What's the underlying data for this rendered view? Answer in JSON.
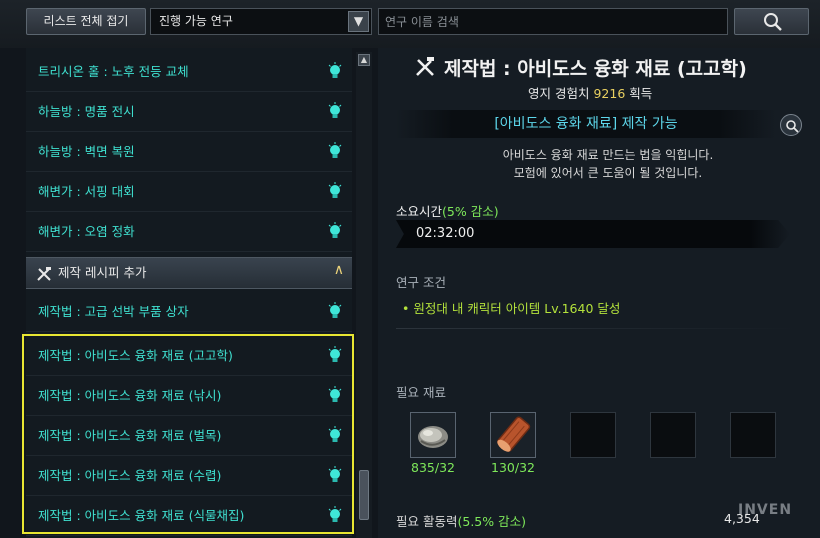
{
  "topbar": {
    "collapse_label": "리스트 전체 접기",
    "filter_value": "진행 가능 연구",
    "search_placeholder": "연구 이름 검색"
  },
  "list": {
    "items": [
      {
        "label": "트리시온 홀 : 노후 전등 교체"
      },
      {
        "label": "하늘방 : 명품 전시"
      },
      {
        "label": "하늘방 : 벽면 복원"
      },
      {
        "label": "해변가 : 서핑 대회"
      },
      {
        "label": "해변가 : 오염 정화"
      }
    ],
    "section_title": "제작 레시피 추가",
    "section_items": [
      {
        "label": "제작법 : 고급 선박 부품 상자"
      },
      {
        "label": "제작법 : 아비도스 융화 재료 (고고학)"
      },
      {
        "label": "제작법 : 아비도스 융화 재료 (낚시)"
      },
      {
        "label": "제작법 : 아비도스 융화 재료 (벌목)"
      },
      {
        "label": "제작법 : 아비도스 융화 재료 (수렵)"
      },
      {
        "label": "제작법 : 아비도스 융화 재료 (식물채집)"
      }
    ]
  },
  "detail": {
    "title": "제작법 : 아비도스 융화 재료 (고고학)",
    "xp_prefix": "영지 경험치",
    "xp_value": "9216",
    "xp_suffix": "획득",
    "craft_banner": "[아비도스 융화 재료] 제작 가능",
    "desc_line1": "아비도스 융화 재료 만드는 법을 익힙니다.",
    "desc_line2": "모험에 있어서 큰 도움이 될 것입니다.",
    "time_label": "소요시간",
    "time_bonus": "(5% 감소)",
    "time_value": "02:32:00",
    "condition_label": "연구 조건",
    "condition_text": "• 원정대 내 캐릭터 아이템 Lv.1640 달성",
    "materials_label": "필요 재료",
    "materials": [
      {
        "name": "ore-icon",
        "count": "835/32"
      },
      {
        "name": "timber-icon",
        "count": "130/32"
      }
    ],
    "energy_label": "필요 활동력",
    "energy_bonus": "(5.5% 감소)",
    "energy_value": "4,354",
    "watermark": "INVEN"
  },
  "colors": {
    "list_text": "#3fe0d0",
    "highlight": "#e8e632",
    "accent_green": "#7ee85a",
    "condition": "#b4e23c",
    "banner": "#5dd6ea"
  }
}
